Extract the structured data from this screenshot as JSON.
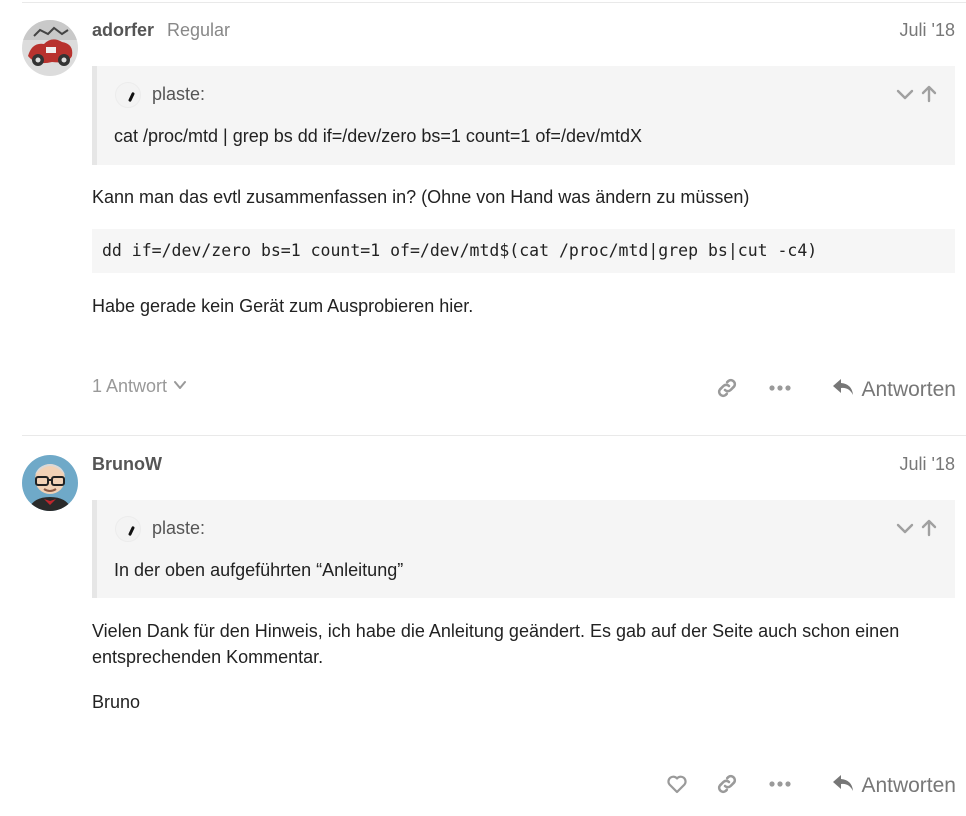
{
  "posts": [
    {
      "username": "adorfer",
      "user_title": "Regular",
      "date": "Juli '18",
      "quote": {
        "username": "plaste:",
        "text": "cat /proc/mtd | grep bs dd if=/dev/zero bs=1 count=1 of=/dev/mtdX"
      },
      "body_text_1": "Kann man das evtl zusammenfassen in? (Ohne von Hand was ändern zu müssen)",
      "code": "dd if=/dev/zero bs=1 count=1 of=/dev/mtd$(cat /proc/mtd|grep bs|cut -c4)",
      "body_text_2": "Habe gerade kein Gerät zum Ausprobieren hier.",
      "replies_label": "1 Antwort",
      "reply_label": "Antworten"
    },
    {
      "username": "BrunoW",
      "date": "Juli '18",
      "quote": {
        "username": "plaste:",
        "text": "In der oben aufgeführten “Anleitung”"
      },
      "body_text_1": "Vielen Dank für den Hinweis, ich habe die Anleitung geändert. Es gab auf der Seite auch schon einen entsprechenden Kommentar.",
      "body_text_2": "Bruno",
      "reply_label": "Antworten"
    }
  ],
  "icons": {
    "expand": "chevron-down-icon",
    "jump": "arrow-up-icon",
    "link": "link-icon",
    "more": "ellipsis-icon",
    "reply": "reply-arrow-icon",
    "like": "heart-icon"
  },
  "colors": {
    "muted_text": "#999999",
    "quote_bg": "#f5f5f5",
    "code_bg": "#f6f6f6"
  }
}
